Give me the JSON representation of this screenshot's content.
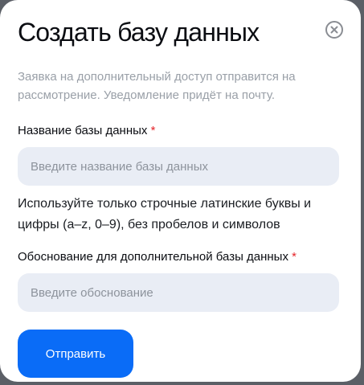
{
  "modal": {
    "title": "Создать базу данных",
    "subtitle": "Заявка на дополнительный доступ отправится на рассмотрение. Уведомление придёт на почту.",
    "close_icon": "close-circle-icon"
  },
  "form": {
    "db_name": {
      "label": "Название базы данных",
      "required_mark": "*",
      "placeholder": "Введите название базы данных",
      "value": ""
    },
    "hint": "Используйте только строчные латинские буквы и цифры (a–z, 0–9), без пробелов и символов",
    "justification": {
      "label": "Обоснование для дополнительной базы данных",
      "required_mark": "*",
      "placeholder": "Введите обоснование",
      "value": ""
    },
    "submit_label": "Отправить"
  },
  "colors": {
    "accent": "#0a6cf7",
    "required": "#e5242a",
    "input_bg": "#e9edf5"
  }
}
